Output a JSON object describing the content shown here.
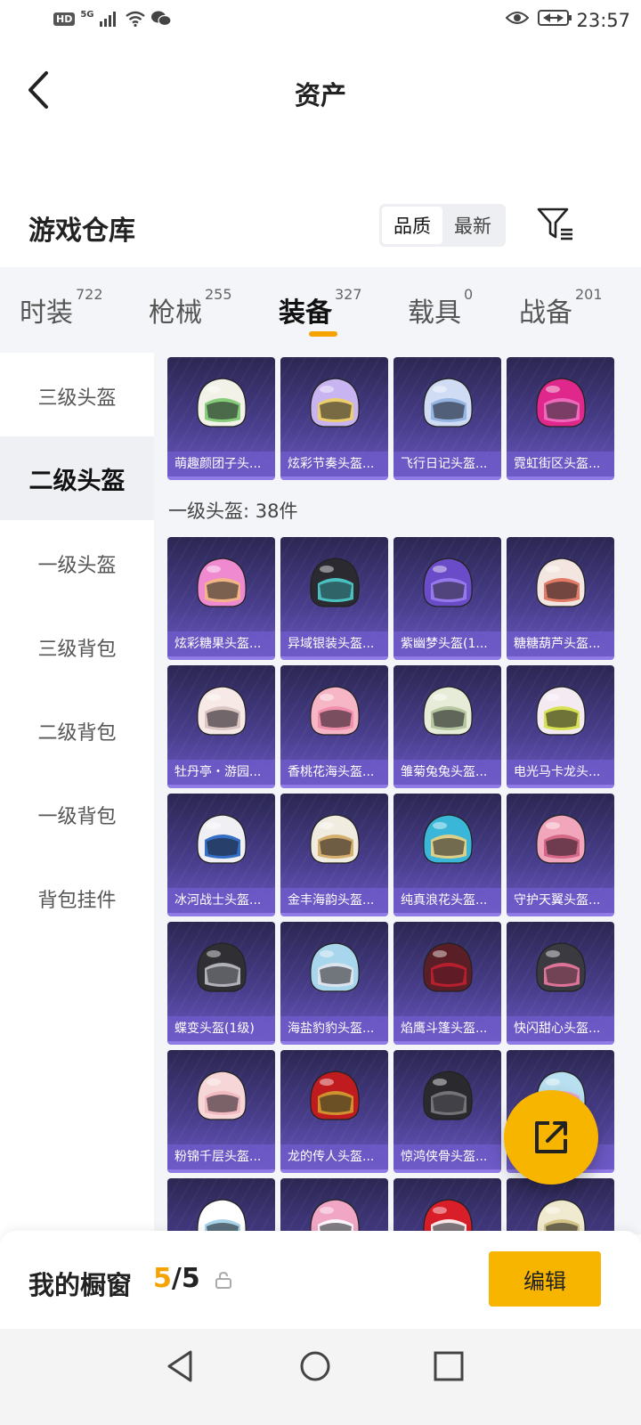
{
  "status_bar": {
    "time": "23:57",
    "hd_badge": "HD",
    "network": "5G",
    "icons": [
      "signal-icon",
      "wifi-icon",
      "wechat-icon",
      "eye-icon",
      "battery-icon"
    ]
  },
  "header": {
    "title": "资产",
    "back_icon": "chevron-left-icon"
  },
  "warehouse": {
    "title": "游戏仓库",
    "sort_options": [
      "品质",
      "最新"
    ],
    "sort_selected": "品质",
    "filter_icon": "filter-icon"
  },
  "tabs": [
    {
      "label": "时装",
      "count": "722"
    },
    {
      "label": "枪械",
      "count": "255"
    },
    {
      "label": "装备",
      "count": "327",
      "active": true
    },
    {
      "label": "载具",
      "count": "0"
    },
    {
      "label": "战备",
      "count": "201"
    }
  ],
  "sidebar": {
    "items": [
      {
        "label": "三级头盔"
      },
      {
        "label": "二级头盔",
        "active": true
      },
      {
        "label": "一级头盔"
      },
      {
        "label": "三级背包"
      },
      {
        "label": "二级背包"
      },
      {
        "label": "一级背包"
      },
      {
        "label": "背包挂件"
      }
    ]
  },
  "top_row_items": [
    "萌趣颜团子头...",
    "炫彩节奏头盔...",
    "飞行日记头盔...",
    "霓虹街区头盔..."
  ],
  "section": {
    "label": "一级头盔: 38件"
  },
  "level1_items": [
    [
      "炫彩糖果头盔...",
      "异域银装头盔...",
      "紫幽梦头盔(1...",
      "糖糖葫芦头盔..."
    ],
    [
      "牡丹亭・游园...",
      "香桃花海头盔...",
      "雏菊兔兔头盔...",
      "电光马卡龙头..."
    ],
    [
      "冰河战士头盔...",
      "金丰海韵头盔...",
      "纯真浪花头盔...",
      "守护天翼头盔..."
    ],
    [
      "蝶变头盔(1级)",
      "海盐豹豹头盔...",
      "焰鹰斗篷头盔...",
      "快闪甜心头盔..."
    ],
    [
      "粉锦千层头盔...",
      "龙的传人头盔...",
      "惊鸿侠骨头盔...",
      "..."
    ]
  ],
  "colors": {
    "accent": "#f7b500",
    "card_top": "#2b2752",
    "card_bottom": "#6b58c2",
    "label_bg": "#6e5ac8"
  },
  "showcase": {
    "title": "我的橱窗",
    "count_current": "5",
    "count_separator": "/",
    "count_total": "5",
    "edit_label": "编辑"
  },
  "fab_icon": "share-icon",
  "navbar": {
    "icons": [
      "nav-back-icon",
      "nav-home-icon",
      "nav-recents-icon"
    ]
  }
}
